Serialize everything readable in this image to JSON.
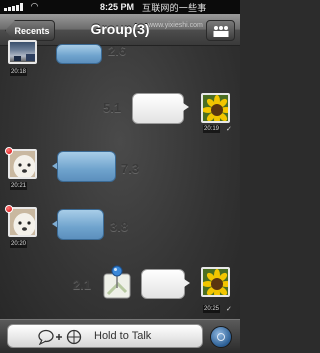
{
  "status_bar": {
    "time": "8:25 PM",
    "watermark": "互联网的一些事",
    "watermark_url": "www.yixieshi.com"
  },
  "nav_bar": {
    "back_label": "Recents",
    "title": "Group(3)",
    "members_icon": "group-icon"
  },
  "messages": [
    {
      "side": "left",
      "type": "voice",
      "duration": "2.6",
      "time": "20:18"
    },
    {
      "side": "right",
      "type": "voice",
      "duration": "5.1",
      "time": "20:19",
      "status": "✓"
    },
    {
      "side": "left",
      "type": "voice",
      "duration": "7.3",
      "time": "20:21",
      "unread_badge": true
    },
    {
      "side": "left",
      "type": "voice",
      "duration": "3.8",
      "time": "20:20",
      "unread_badge": true
    },
    {
      "side": "right",
      "type": "voice",
      "duration": "2.1",
      "time": "20:25",
      "status": "✓",
      "attachment_icon": "location-pin-icon"
    }
  ],
  "input_bar": {
    "talk_label": "Hold to Talk",
    "talk_icons": [
      "speech-bubble-icon",
      "plus-icon",
      "emoji-icon"
    ],
    "mode_icon": "keyboard-toggle-icon"
  },
  "colors": {
    "voice_bubble_incoming": "#6fa3cd",
    "voice_bubble_outgoing": "#ffffff",
    "unread_badge": "#d40000"
  }
}
